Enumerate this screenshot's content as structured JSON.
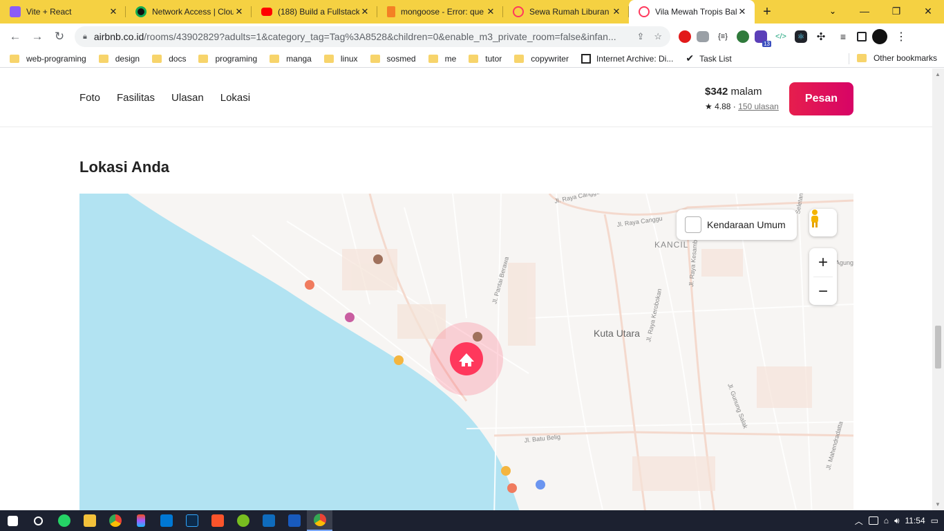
{
  "browser": {
    "tabs": [
      {
        "title": "Vite + React",
        "icon": "vite-icon",
        "color": "#8a5cf6",
        "active": false
      },
      {
        "title": "Network Access | Clou",
        "icon": "mongodb-icon",
        "color": "#13aa52",
        "active": false
      },
      {
        "title": "(188) Build a Fullstack",
        "icon": "youtube-icon",
        "color": "#ff0000",
        "active": false
      },
      {
        "title": "mongoose - Error: que",
        "icon": "stackoverflow-icon",
        "color": "#f48024",
        "active": false
      },
      {
        "title": "Sewa Rumah Liburan &",
        "icon": "airbnb-icon",
        "color": "#ff385c",
        "active": false
      },
      {
        "title": "Vila Mewah Tropis Bal",
        "icon": "airbnb-icon",
        "color": "#ff385c",
        "active": true
      }
    ],
    "url_host": "airbnb.co.id",
    "url_path": "/rooms/43902829?adults=1&category_tag=Tag%3A8528&children=0&enable_m3_private_room=false&infan...",
    "extension_badge": "13",
    "bookmarks": [
      "web-programing",
      "design",
      "docs",
      "programing",
      "manga",
      "linux",
      "sosmed",
      "me",
      "tutor",
      "copywriter",
      "Internet Archive: Di...",
      "Task List"
    ],
    "other_bookmarks": "Other bookmarks"
  },
  "listing_nav": {
    "links": [
      "Foto",
      "Fasilitas",
      "Ulasan",
      "Lokasi"
    ],
    "price": "$342",
    "price_unit": "malam",
    "rating": "4.88",
    "reviews": "150 ulasan",
    "book_button": "Pesan"
  },
  "location": {
    "title": "Lokasi Anda",
    "transit_label": "Kendaraan Umum",
    "zoom_in": "+",
    "zoom_out": "−",
    "map_labels": {
      "area": "Kuta Utara",
      "kancil": "KANCIL",
      "canggu1": "Jl. Raya Canggu",
      "canggu2": "Jl. Raya Canggu",
      "berawa": "Jl. Pantai Berawa",
      "kerobokan": "Jl. Raya Kerobokan",
      "kesambi": "Jl. Raya Kesambi",
      "batu_belig": "Jl. Batu Belig",
      "gunung_salak": "Jl. Gunung Salak",
      "mahendradatta": "Jl. Mahendradatta",
      "agung": "Agung",
      "seletan": "Seletan"
    },
    "colors": {
      "sea": "#b2e3f2",
      "land": "#f7f5f3",
      "pin": "#ff385c"
    }
  },
  "taskbar": {
    "time": "11:54",
    "apps": [
      "windows-start-icon",
      "search-icon",
      "whatsapp-icon",
      "file-explorer-icon",
      "chrome-icon",
      "figma-icon",
      "vscode-icon",
      "photoshop-icon",
      "brave-icon",
      "utorrent-icon",
      "outlook-icon",
      "word-icon",
      "chrome-active-icon"
    ]
  }
}
